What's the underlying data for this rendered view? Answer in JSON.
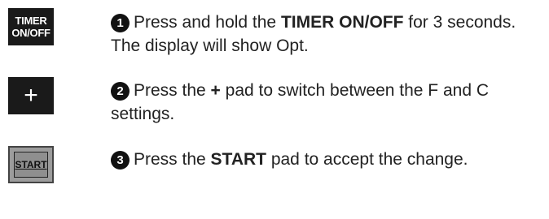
{
  "keys": {
    "timer_line1": "TIMER",
    "timer_line2": "ON/OFF",
    "plus": "+",
    "start": "START"
  },
  "steps": [
    {
      "number": "1",
      "text_before": "Press and hold the ",
      "bold": "TIMER ON/OFF",
      "text_after": " for 3 seconds. The display will show Opt."
    },
    {
      "number": "2",
      "text_before": "Press the ",
      "bold": "+",
      "text_after": " pad to switch between the F and C settings."
    },
    {
      "number": "3",
      "text_before": "Press the ",
      "bold": "START",
      "text_after": " pad to accept the change."
    }
  ]
}
